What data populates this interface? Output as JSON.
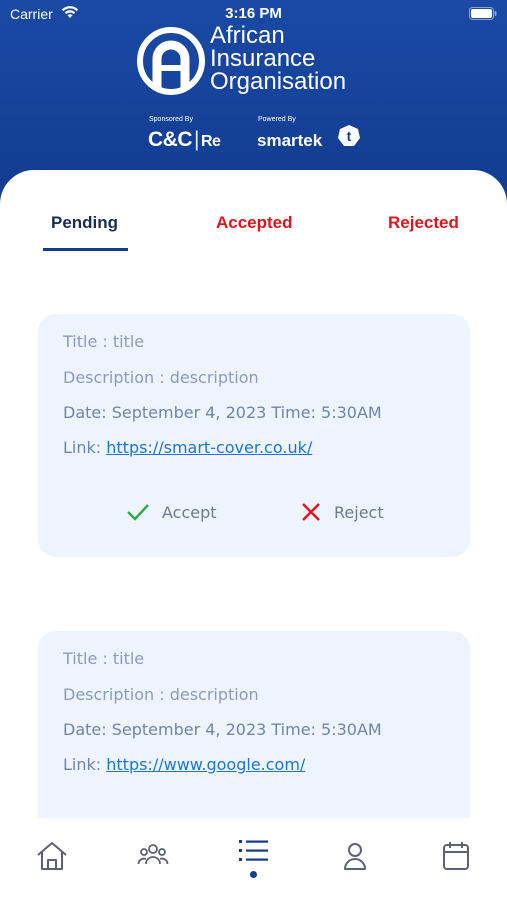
{
  "status_bar": {
    "carrier": "Carrier",
    "time": "3:16 PM"
  },
  "header": {
    "logo_lines": [
      "African",
      "Insurance",
      "Organisation"
    ],
    "sponsored_label": "Sponsored By",
    "sponsor_name_left": "C&C",
    "sponsor_name_right": "Re",
    "powered_label": "Powered By",
    "powered_name": "smartek",
    "powered_badge": "t"
  },
  "tabs": [
    {
      "label": "Pending",
      "active": true
    },
    {
      "label": "Accepted",
      "active": false
    },
    {
      "label": "Rejected",
      "active": false
    }
  ],
  "cards": [
    {
      "title": "Title : title",
      "description": "Description : description",
      "datetime": "Date: September 4, 2023  Time: 5:30AM",
      "link_label": "Link: ",
      "link_url": "https://smart-cover.co.uk/",
      "accept_label": "Accept",
      "reject_label": "Reject"
    },
    {
      "title": "Title : title",
      "description": "Description : description",
      "datetime": "Date: September 4, 2023  Time: 5:30AM",
      "link_label": "Link: ",
      "link_url": "https://www.google.com/"
    }
  ],
  "nav": [
    {
      "icon": "home-icon"
    },
    {
      "icon": "people-icon"
    },
    {
      "icon": "list-icon",
      "active": true
    },
    {
      "icon": "profile-icon"
    },
    {
      "icon": "calendar-icon"
    }
  ],
  "colors": {
    "brand_blue": "#123a8f",
    "tab_inactive_red": "#e0141c",
    "card_bg": "#eef4fe",
    "accept_green": "#2ba84a",
    "reject_red": "#e0141c",
    "link_blue": "#1e73d8"
  }
}
